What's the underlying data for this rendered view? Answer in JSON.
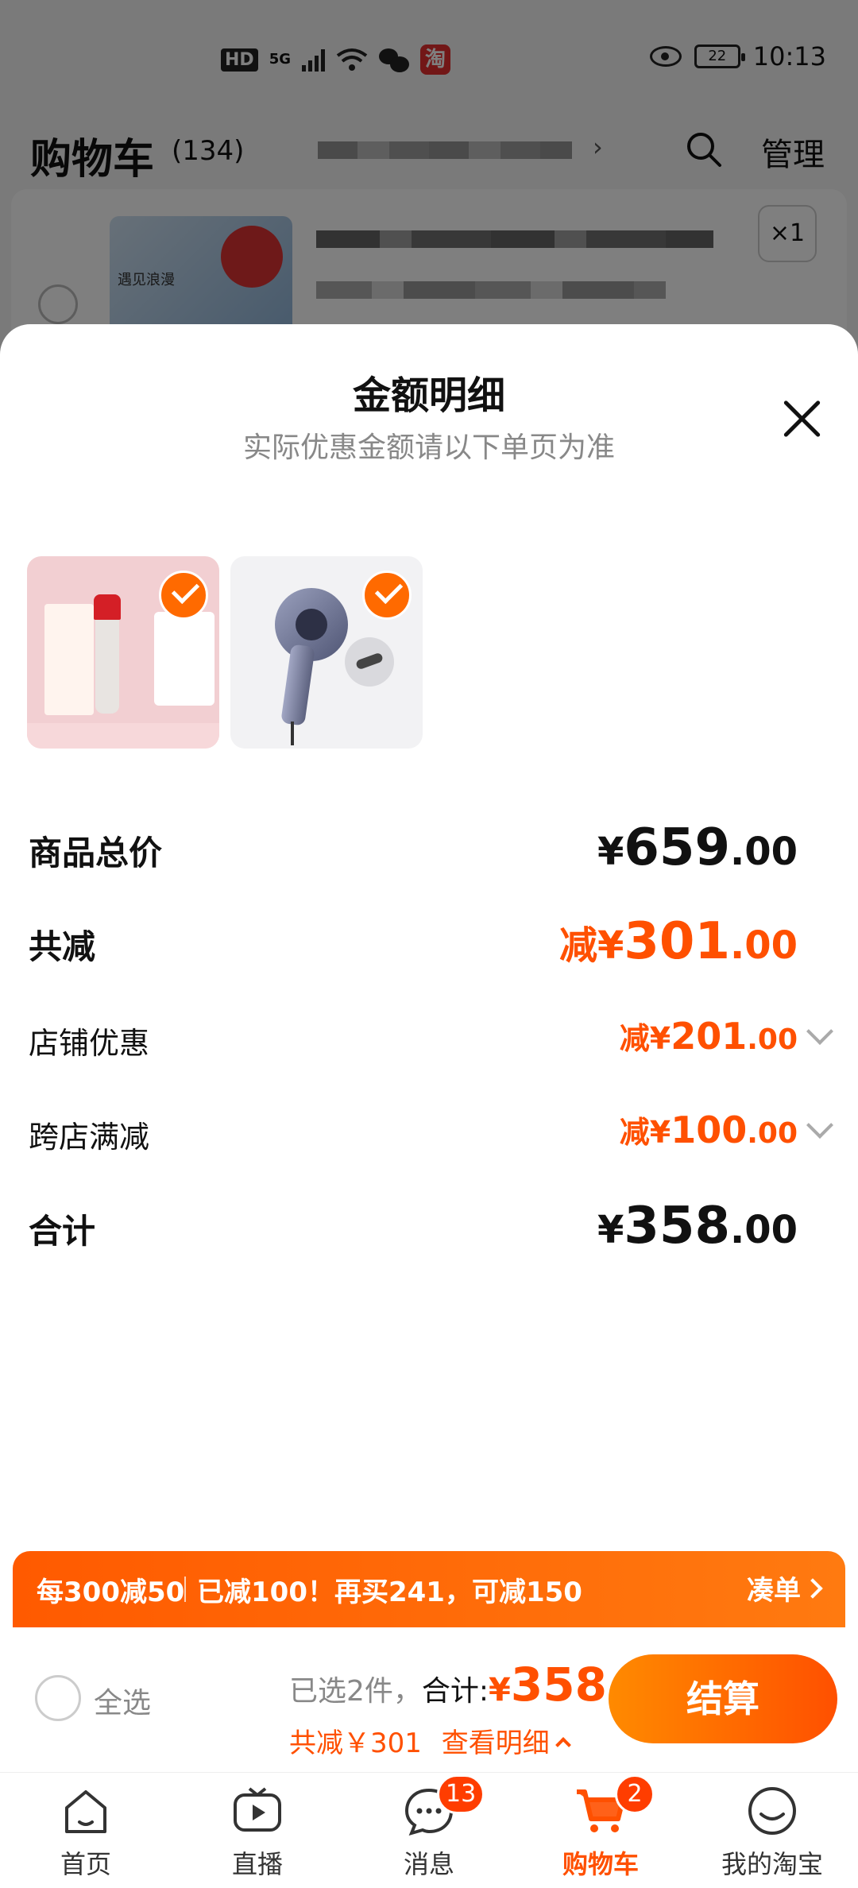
{
  "status_bar": {
    "hd": "HD",
    "network": "5G",
    "app_badge": "淘",
    "battery": "22",
    "time": "10:13"
  },
  "header": {
    "title": "购物车",
    "count": "(134)",
    "manage_label": "管理"
  },
  "background_item": {
    "thumb_caption": "遇见浪漫",
    "quantity": "×1"
  },
  "sheet": {
    "title": "金额明细",
    "subtitle": "实际优惠金额请以下单页为准",
    "products_selected": 2,
    "rows": {
      "total": {
        "label": "商品总价",
        "prefix": "",
        "currency": "¥",
        "integer": "659",
        "decimal": ".00"
      },
      "reduce": {
        "label": "共减",
        "prefix": "减",
        "currency": "¥",
        "integer": "301",
        "decimal": ".00"
      },
      "shop": {
        "label": "店铺优惠",
        "prefix": "减",
        "currency": "¥",
        "integer": "201",
        "decimal": ".00"
      },
      "cross": {
        "label": "跨店满减",
        "prefix": "减",
        "currency": "¥",
        "integer": "100",
        "decimal": ".00"
      },
      "sum": {
        "label": "合计",
        "prefix": "",
        "currency": "¥",
        "integer": "358",
        "decimal": ".00"
      }
    }
  },
  "promo": {
    "rule": "每300减50",
    "status": "已减100！再买241，可减150",
    "link": "凑单"
  },
  "checkout": {
    "select_all": "全选",
    "selected": "已选2件，",
    "total_label": "合计:",
    "currency": "¥",
    "total": "358",
    "reduce": "共减￥301",
    "detail_link": "查看明细",
    "pay_button": "结算"
  },
  "tabbar": {
    "items": [
      {
        "label": "首页",
        "icon": "home-icon"
      },
      {
        "label": "直播",
        "icon": "live-play-icon"
      },
      {
        "label": "消息",
        "icon": "message-icon",
        "badge": "13"
      },
      {
        "label": "购物车",
        "icon": "cart-icon",
        "badge": "2",
        "active": true
      },
      {
        "label": "我的淘宝",
        "icon": "profile-smile-icon"
      }
    ]
  },
  "colors": {
    "accent": "#ff5000",
    "accent_light": "#ff8a00",
    "text": "#111111",
    "muted": "#888888"
  }
}
